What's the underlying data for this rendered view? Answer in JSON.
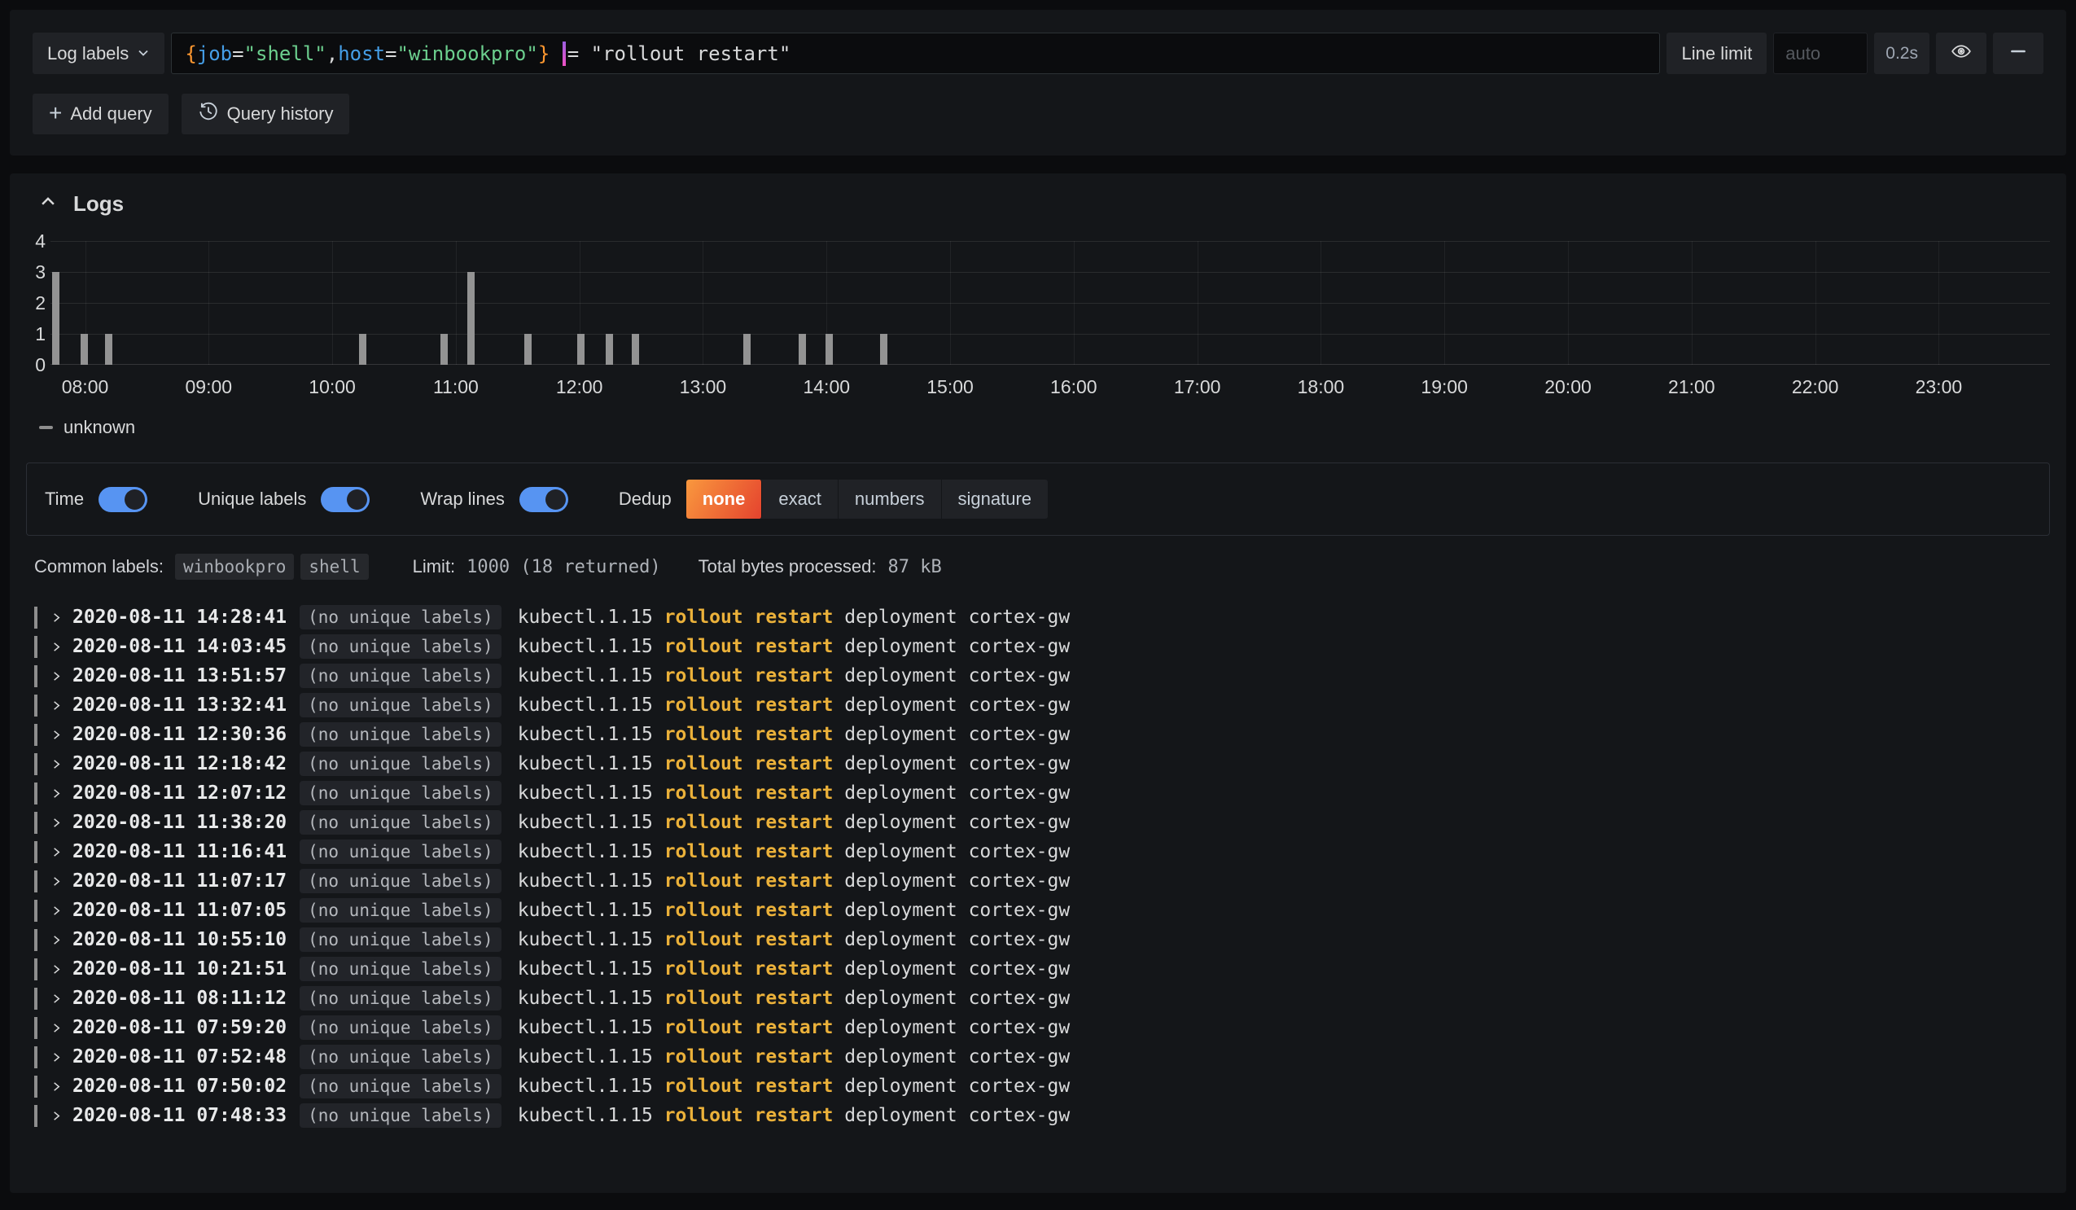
{
  "colors": {
    "page_bg": "#0b0c0e",
    "panel_bg": "#141619",
    "accent_blue_toggle": "#5794F2",
    "dedup_active_gradient": [
      "#F9983E",
      "#E5432E"
    ],
    "match_highlight": "#EBB13A",
    "bar_color": "#939393",
    "syntax_brace": "#FF9830",
    "syntax_key": "#459EE7",
    "syntax_string": "#6CCF8E",
    "cursor_pink": "#E55FDE"
  },
  "query_editor": {
    "log_labels_button": "Log labels",
    "query": "{job=\"shell\",host=\"winbookpro\"} |= \"rollout restart\"",
    "query_tokens": [
      {
        "t": "{",
        "c": "brace"
      },
      {
        "t": "job",
        "c": "key"
      },
      {
        "t": "=",
        "c": "op"
      },
      {
        "t": "\"shell\"",
        "c": "str"
      },
      {
        "t": ",",
        "c": "op"
      },
      {
        "t": "host",
        "c": "key"
      },
      {
        "t": "=",
        "c": "op"
      },
      {
        "t": "\"winbookpro\"",
        "c": "str"
      },
      {
        "t": "}",
        "c": "brace"
      },
      {
        "t": " ",
        "c": "op"
      },
      {
        "t": "|",
        "c": "pipe"
      },
      {
        "t": "= \"rollout restart\"",
        "c": "op"
      }
    ],
    "line_limit_label": "Line limit",
    "line_limit_placeholder": "auto",
    "duration_badge": "0.2s",
    "add_query_label": "Add query",
    "query_history_label": "Query history"
  },
  "logs_panel": {
    "title": "Logs",
    "legend_label": "unknown",
    "controls": {
      "toggles": [
        {
          "label": "Time",
          "on": true
        },
        {
          "label": "Unique labels",
          "on": true
        },
        {
          "label": "Wrap lines",
          "on": true
        }
      ],
      "dedup_label": "Dedup",
      "dedup_options": [
        "none",
        "exact",
        "numbers",
        "signature"
      ],
      "dedup_selected": "none"
    },
    "meta": {
      "common_labels_label": "Common labels:",
      "common_labels": [
        "winbookpro",
        "shell"
      ],
      "limit_label": "Limit:",
      "limit_value": "1000 (18 returned)",
      "bytes_label": "Total bytes processed:",
      "bytes_value": "87 kB"
    },
    "rows": [
      {
        "time": "2020-08-11 14:28:41",
        "labels": "(no unique labels)",
        "message_pre": "kubectl.1.15 ",
        "message_match": "rollout restart",
        "message_post": " deployment cortex-gw"
      },
      {
        "time": "2020-08-11 14:03:45",
        "labels": "(no unique labels)",
        "message_pre": "kubectl.1.15 ",
        "message_match": "rollout restart",
        "message_post": " deployment cortex-gw"
      },
      {
        "time": "2020-08-11 13:51:57",
        "labels": "(no unique labels)",
        "message_pre": "kubectl.1.15 ",
        "message_match": "rollout restart",
        "message_post": " deployment cortex-gw"
      },
      {
        "time": "2020-08-11 13:32:41",
        "labels": "(no unique labels)",
        "message_pre": "kubectl.1.15 ",
        "message_match": "rollout restart",
        "message_post": " deployment cortex-gw"
      },
      {
        "time": "2020-08-11 12:30:36",
        "labels": "(no unique labels)",
        "message_pre": "kubectl.1.15 ",
        "message_match": "rollout restart",
        "message_post": " deployment cortex-gw"
      },
      {
        "time": "2020-08-11 12:18:42",
        "labels": "(no unique labels)",
        "message_pre": "kubectl.1.15 ",
        "message_match": "rollout restart",
        "message_post": " deployment cortex-gw"
      },
      {
        "time": "2020-08-11 12:07:12",
        "labels": "(no unique labels)",
        "message_pre": "kubectl.1.15 ",
        "message_match": "rollout restart",
        "message_post": " deployment cortex-gw"
      },
      {
        "time": "2020-08-11 11:38:20",
        "labels": "(no unique labels)",
        "message_pre": "kubectl.1.15 ",
        "message_match": "rollout restart",
        "message_post": " deployment cortex-gw"
      },
      {
        "time": "2020-08-11 11:16:41",
        "labels": "(no unique labels)",
        "message_pre": "kubectl.1.15 ",
        "message_match": "rollout restart",
        "message_post": " deployment cortex-gw"
      },
      {
        "time": "2020-08-11 11:07:17",
        "labels": "(no unique labels)",
        "message_pre": "kubectl.1.15 ",
        "message_match": "rollout restart",
        "message_post": " deployment cortex-gw"
      },
      {
        "time": "2020-08-11 11:07:05",
        "labels": "(no unique labels)",
        "message_pre": "kubectl.1.15 ",
        "message_match": "rollout restart",
        "message_post": " deployment cortex-gw"
      },
      {
        "time": "2020-08-11 10:55:10",
        "labels": "(no unique labels)",
        "message_pre": "kubectl.1.15 ",
        "message_match": "rollout restart",
        "message_post": " deployment cortex-gw"
      },
      {
        "time": "2020-08-11 10:21:51",
        "labels": "(no unique labels)",
        "message_pre": "kubectl.1.15 ",
        "message_match": "rollout restart",
        "message_post": " deployment cortex-gw"
      },
      {
        "time": "2020-08-11 08:11:12",
        "labels": "(no unique labels)",
        "message_pre": "kubectl.1.15 ",
        "message_match": "rollout restart",
        "message_post": " deployment cortex-gw"
      },
      {
        "time": "2020-08-11 07:59:20",
        "labels": "(no unique labels)",
        "message_pre": "kubectl.1.15 ",
        "message_match": "rollout restart",
        "message_post": " deployment cortex-gw"
      },
      {
        "time": "2020-08-11 07:52:48",
        "labels": "(no unique labels)",
        "message_pre": "kubectl.1.15 ",
        "message_match": "rollout restart",
        "message_post": " deployment cortex-gw"
      },
      {
        "time": "2020-08-11 07:50:02",
        "labels": "(no unique labels)",
        "message_pre": "kubectl.1.15 ",
        "message_match": "rollout restart",
        "message_post": " deployment cortex-gw"
      },
      {
        "time": "2020-08-11 07:48:33",
        "labels": "(no unique labels)",
        "message_pre": "kubectl.1.15 ",
        "message_match": "rollout restart",
        "message_post": " deployment cortex-gw"
      }
    ]
  },
  "chart_data": {
    "type": "bar",
    "title": "Log volume histogram",
    "series": [
      {
        "name": "unknown",
        "color": "#939393",
        "points": [
          {
            "x": 7.76,
            "y": 3
          },
          {
            "x": 7.99,
            "y": 1
          },
          {
            "x": 8.19,
            "y": 1
          },
          {
            "x": 10.24,
            "y": 1
          },
          {
            "x": 10.9,
            "y": 1
          },
          {
            "x": 11.12,
            "y": 3
          },
          {
            "x": 11.58,
            "y": 1
          },
          {
            "x": 12.01,
            "y": 1
          },
          {
            "x": 12.24,
            "y": 1
          },
          {
            "x": 12.45,
            "y": 1
          },
          {
            "x": 13.35,
            "y": 1
          },
          {
            "x": 13.8,
            "y": 1
          },
          {
            "x": 14.02,
            "y": 1
          },
          {
            "x": 14.46,
            "y": 1
          }
        ]
      }
    ],
    "x_unit": "hour-of-day 2020-08-11",
    "x_range": [
      7.72,
      23.9
    ],
    "x_tick_hours": [
      8,
      9,
      10,
      11,
      12,
      13,
      14,
      15,
      16,
      17,
      18,
      19,
      20,
      21,
      22,
      23
    ],
    "x_tick_labels": [
      "08:00",
      "09:00",
      "10:00",
      "11:00",
      "12:00",
      "13:00",
      "14:00",
      "15:00",
      "16:00",
      "17:00",
      "18:00",
      "19:00",
      "20:00",
      "21:00",
      "22:00",
      "23:00"
    ],
    "y_ticks": [
      0,
      1,
      2,
      3,
      4
    ],
    "ylim": [
      0,
      4
    ],
    "grid": true,
    "legend_position": "bottom-left"
  }
}
